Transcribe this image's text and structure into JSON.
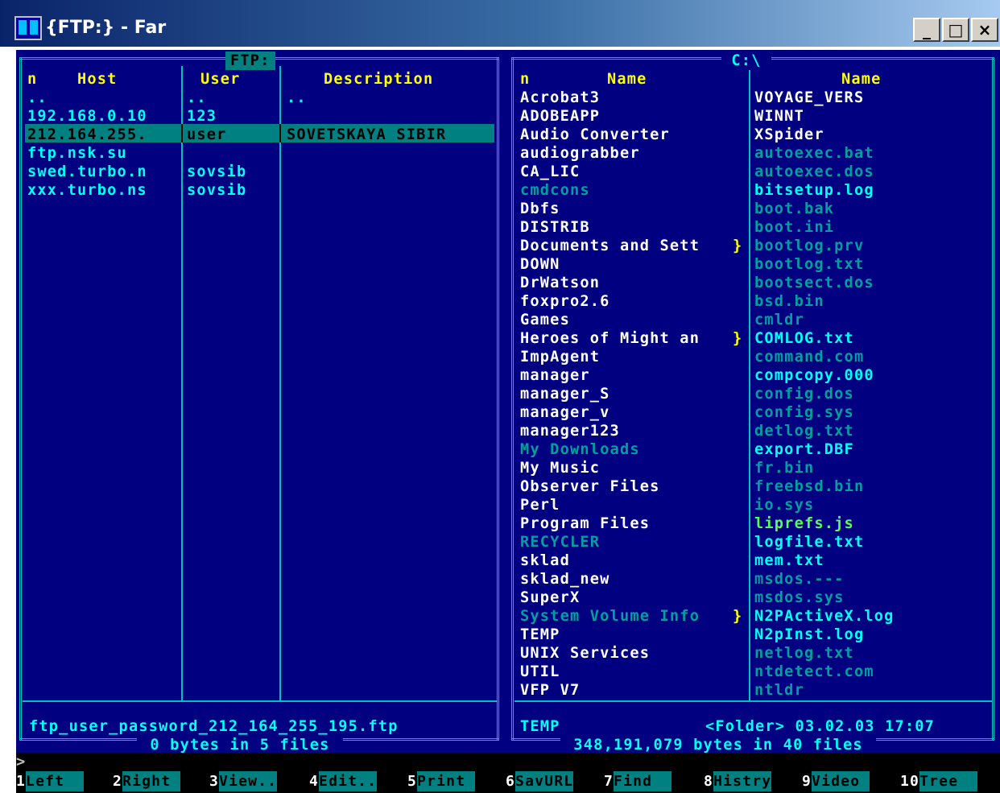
{
  "window": {
    "title": "{FTP:} - Far",
    "minimize": "_",
    "maximize": "□",
    "close": "×"
  },
  "left_panel": {
    "title": "FTP:",
    "columns": [
      "n",
      "Host",
      "User",
      "Description"
    ],
    "rows": [
      {
        "host": "..",
        "user": "..",
        "desc": ".."
      },
      {
        "host": "192.168.0.10",
        "user": "123",
        "desc": ""
      },
      {
        "host": "212.164.255.",
        "user": "user",
        "desc": "SOVETSKAYA SIBIR"
      },
      {
        "host": "ftp.nsk.su",
        "user": "",
        "desc": ""
      },
      {
        "host": "swed.turbo.n",
        "user": "sovsib",
        "desc": ""
      },
      {
        "host": "xxx.turbo.ns",
        "user": "sovsib",
        "desc": ""
      }
    ],
    "selected_index": 2,
    "status_file": "ftp_user_password_212_164_255_195.ftp",
    "footer": " 0 bytes in 5 files "
  },
  "right_panel": {
    "title": " C:\\ ",
    "columns": [
      "n",
      "Name",
      "Name"
    ],
    "col1": [
      {
        "name": "Acrobat3",
        "style": "wh"
      },
      {
        "name": "ADOBEAPP",
        "style": "wh"
      },
      {
        "name": "Audio Converter",
        "style": "wh"
      },
      {
        "name": "audiograbber",
        "style": "wh"
      },
      {
        "name": "CA_LIC",
        "style": "wh"
      },
      {
        "name": "cmdcons",
        "style": "hid"
      },
      {
        "name": "Dbfs",
        "style": "wh"
      },
      {
        "name": "DISTRIB",
        "style": "wh"
      },
      {
        "name": "Documents and Sett",
        "style": "wh",
        "more": true
      },
      {
        "name": "DOWN",
        "style": "wh"
      },
      {
        "name": "DrWatson",
        "style": "wh"
      },
      {
        "name": "foxpro2.6",
        "style": "wh"
      },
      {
        "name": "Games",
        "style": "wh"
      },
      {
        "name": "Heroes of Might an",
        "style": "wh",
        "more": true
      },
      {
        "name": "ImpAgent",
        "style": "wh"
      },
      {
        "name": "manager",
        "style": "wh"
      },
      {
        "name": "manager_S",
        "style": "wh"
      },
      {
        "name": "manager_v",
        "style": "wh"
      },
      {
        "name": "manager123",
        "style": "wh"
      },
      {
        "name": "My Downloads",
        "style": "hid"
      },
      {
        "name": "My Music",
        "style": "wh"
      },
      {
        "name": "Observer Files",
        "style": "wh"
      },
      {
        "name": "Perl",
        "style": "wh"
      },
      {
        "name": "Program Files",
        "style": "wh"
      },
      {
        "name": "RECYCLER",
        "style": "hid"
      },
      {
        "name": "sklad",
        "style": "wh"
      },
      {
        "name": "sklad_new",
        "style": "wh"
      },
      {
        "name": "SuperX",
        "style": "wh"
      },
      {
        "name": "System Volume Info",
        "style": "hid",
        "more": true
      },
      {
        "name": "TEMP",
        "style": "wh"
      },
      {
        "name": "UNIX Services",
        "style": "wh"
      },
      {
        "name": "UTIL",
        "style": "wh"
      },
      {
        "name": "VFP V7",
        "style": "wh"
      }
    ],
    "col2": [
      {
        "name": "VOYAGE_VERS",
        "style": "wh"
      },
      {
        "name": "WINNT",
        "style": "wh"
      },
      {
        "name": "XSpider",
        "style": "wh"
      },
      {
        "name": "autoexec.bat",
        "style": "hid"
      },
      {
        "name": "autoexec.dos",
        "style": "hid"
      },
      {
        "name": "bitsetup.log",
        "style": "cy"
      },
      {
        "name": "boot.bak",
        "style": "hid"
      },
      {
        "name": "boot.ini",
        "style": "hid"
      },
      {
        "name": "bootlog.prv",
        "style": "hid"
      },
      {
        "name": "bootlog.txt",
        "style": "hid"
      },
      {
        "name": "bootsect.dos",
        "style": "hid"
      },
      {
        "name": "bsd.bin",
        "style": "hid"
      },
      {
        "name": "cmldr",
        "style": "hid"
      },
      {
        "name": "COMLOG.txt",
        "style": "cy"
      },
      {
        "name": "command.com",
        "style": "hid"
      },
      {
        "name": "compcopy.000",
        "style": "cy"
      },
      {
        "name": "config.dos",
        "style": "hid"
      },
      {
        "name": "config.sys",
        "style": "hid"
      },
      {
        "name": "detlog.txt",
        "style": "hid"
      },
      {
        "name": "export.DBF",
        "style": "cy"
      },
      {
        "name": "fr.bin",
        "style": "hid"
      },
      {
        "name": "freebsd.bin",
        "style": "hid"
      },
      {
        "name": "io.sys",
        "style": "hid"
      },
      {
        "name": "liprefs.js",
        "style": "lime"
      },
      {
        "name": "logfile.txt",
        "style": "cy"
      },
      {
        "name": "mem.txt",
        "style": "cy"
      },
      {
        "name": "msdos.---",
        "style": "hid"
      },
      {
        "name": "msdos.sys",
        "style": "hid"
      },
      {
        "name": "N2PActiveX.log",
        "style": "cy"
      },
      {
        "name": "N2pInst.log",
        "style": "cy"
      },
      {
        "name": "netlog.txt",
        "style": "hid"
      },
      {
        "name": "ntdetect.com",
        "style": "hid"
      },
      {
        "name": "ntldr",
        "style": "hid"
      }
    ],
    "status_name": "TEMP",
    "status_info": "<Folder> 03.02.03 17:07",
    "footer": " 348,191,079 bytes in 40 files "
  },
  "command_prompt": ">",
  "keybar": [
    {
      "num": "1",
      "label": "Left  "
    },
    {
      "num": "2",
      "label": "Right "
    },
    {
      "num": "3",
      "label": "View.."
    },
    {
      "num": "4",
      "label": "Edit.."
    },
    {
      "num": "5",
      "label": "Print "
    },
    {
      "num": "6",
      "label": "SavURL"
    },
    {
      "num": "7",
      "label": "Find  "
    },
    {
      "num": "8",
      "label": "Histry"
    },
    {
      "num": "9",
      "label": "Video "
    },
    {
      "num": "10",
      "label": "Tree  "
    }
  ]
}
